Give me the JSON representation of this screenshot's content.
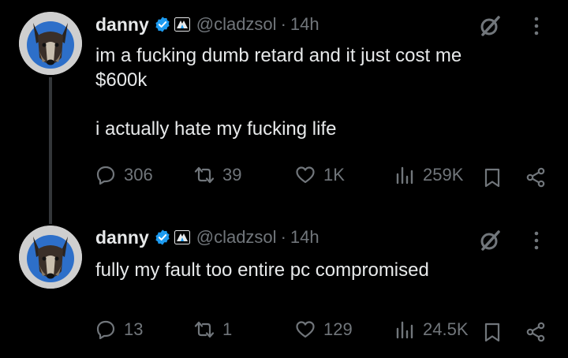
{
  "tweets": [
    {
      "name": "danny",
      "handle": "@cladzsol",
      "separator": "·",
      "time": "14h",
      "text": "im a fucking dumb retard and it just cost me\n$600k\n\ni actually hate my fucking life",
      "replies": "306",
      "reposts": "39",
      "likes": "1K",
      "views": "259K"
    },
    {
      "name": "danny",
      "handle": "@cladzsol",
      "separator": "·",
      "time": "14h",
      "text": "fully my fault too entire pc compromised",
      "replies": "13",
      "reposts": "1",
      "likes": "129",
      "views": "24.5K"
    }
  ],
  "colors": {
    "background": "#000000",
    "text": "#e7e9ea",
    "muted": "#71767b",
    "verified": "#1d9bf0",
    "thread_line": "#333639"
  }
}
